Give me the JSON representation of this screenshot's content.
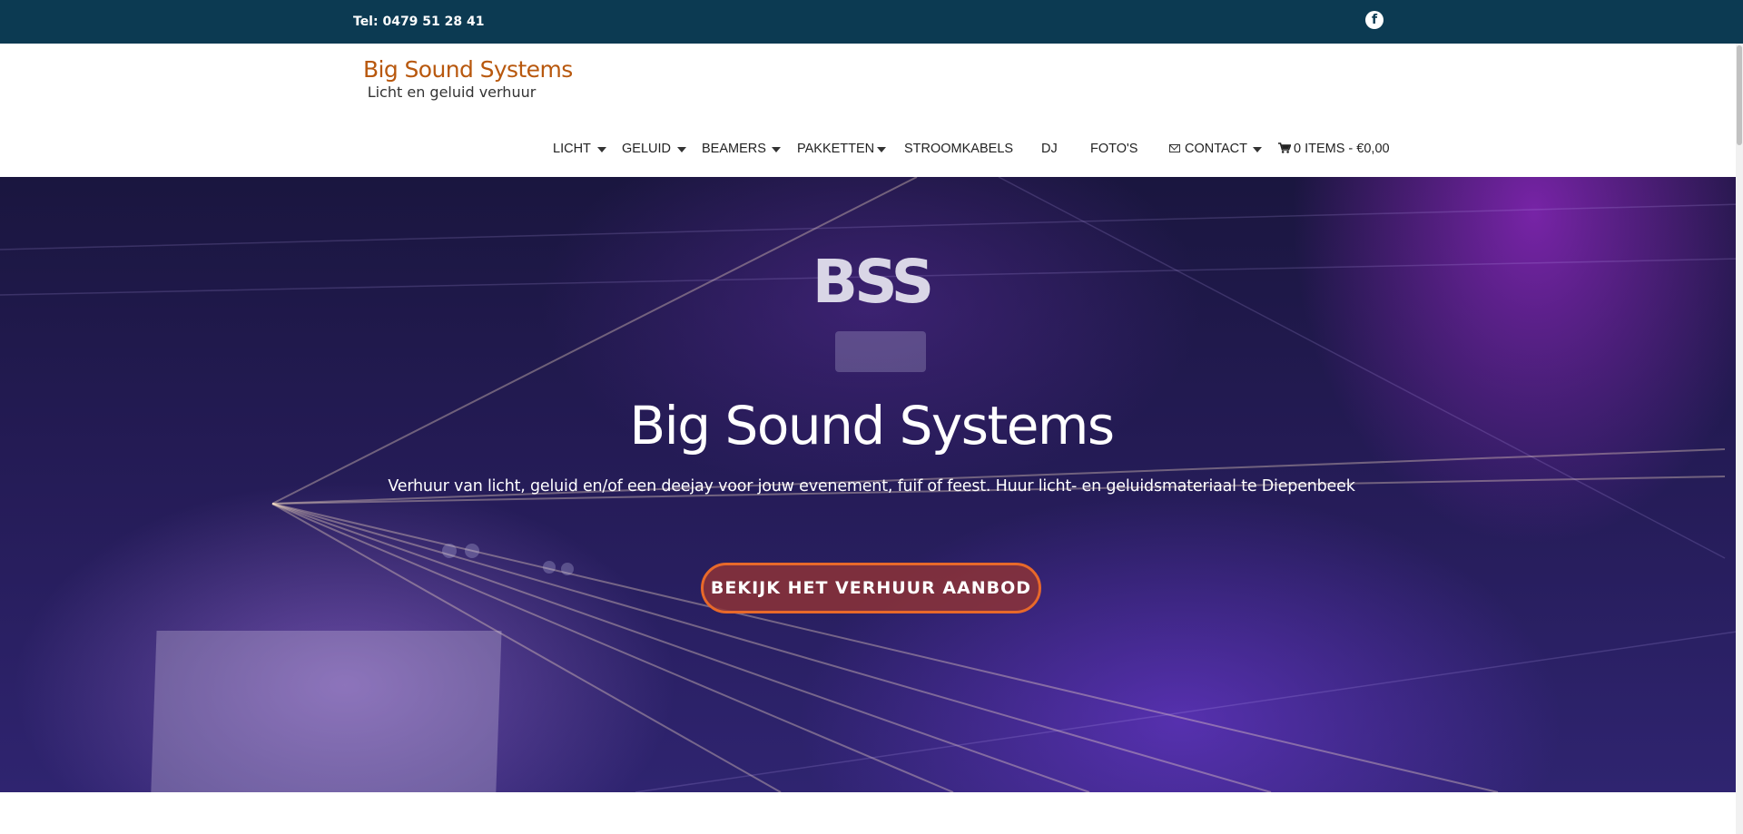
{
  "topbar": {
    "phone": "Tel: 0479 51 28 41",
    "social_icon": "facebook-icon",
    "background": "#0c3a52"
  },
  "brand": {
    "name": "Big Sound Systems",
    "tagline": "Licht en geluid verhuur",
    "name_color": "#b8580e"
  },
  "nav": {
    "items": [
      {
        "label": "LICHT",
        "has_dropdown": true
      },
      {
        "label": "GELUID",
        "has_dropdown": true
      },
      {
        "label": "BEAMERS",
        "has_dropdown": true
      },
      {
        "label": "PAKKETTEN",
        "has_dropdown": true
      },
      {
        "label": "STROOMKABELS",
        "has_dropdown": false
      },
      {
        "label": "DJ",
        "has_dropdown": false
      },
      {
        "label": "FOTO'S",
        "has_dropdown": false
      },
      {
        "label": "CONTACT",
        "has_dropdown": true,
        "icon": "mail-icon"
      }
    ],
    "cart": {
      "label": "0 ITEMS - €0,00",
      "icon": "cart-icon"
    }
  },
  "hero": {
    "logo_text": "BSS",
    "title": "Big Sound Systems",
    "subtitle": "Verhuur van licht, geluid en/of een deejay voor jouw evenement, fuif of feest. Huur licht- en geluidsmateriaal te Diepenbeek",
    "cta_label": "BEKIJK HET VERHUUR AANBOD",
    "cta_border_color": "#e8692a"
  }
}
